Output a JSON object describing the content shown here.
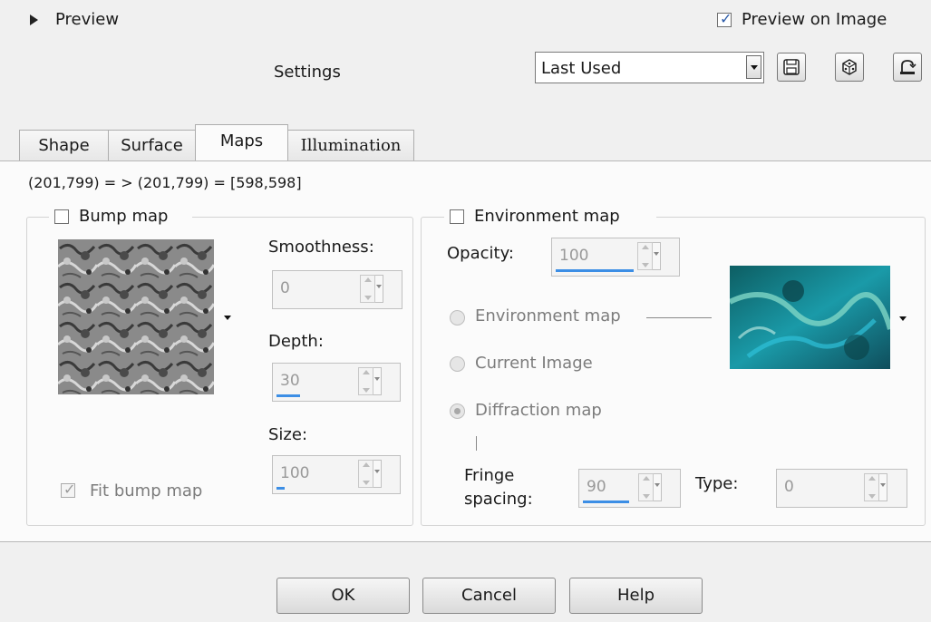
{
  "header": {
    "preview_label": "Preview",
    "preview_on_image_label": "Preview on Image",
    "preview_on_image_checked": true,
    "settings_label": "Settings",
    "settings_value": "Last Used",
    "icons": [
      "save-preset-icon",
      "random-dice-icon",
      "reset-icon"
    ]
  },
  "tabs": [
    {
      "label": "Shape",
      "active": false
    },
    {
      "label": "Surface",
      "active": false
    },
    {
      "label": "Maps",
      "active": true
    },
    {
      "label": "Illumination",
      "active": false
    }
  ],
  "coords": "(201,799) = > (201,799) = [598,598]",
  "bump_map": {
    "label": "Bump map",
    "checked": false,
    "smoothness_label": "Smoothness:",
    "smoothness_value": "0",
    "depth_label": "Depth:",
    "depth_value": "30",
    "depth_fraction": 0.3,
    "size_label": "Size:",
    "size_value": "100",
    "size_fraction": 0.1,
    "fit_label": "Fit bump map",
    "fit_checked": true
  },
  "environment_map": {
    "label": "Environment map",
    "checked": false,
    "opacity_label": "Opacity:",
    "opacity_value": "100",
    "opacity_fraction": 1.0,
    "radio_environment_label": "Environment map",
    "radio_current_label": "Current Image",
    "radio_diffraction_label": "Diffraction map",
    "selected_radio": "Diffraction map",
    "fringe_label_1": "Fringe",
    "fringe_label_2": "spacing:",
    "fringe_value": "90",
    "fringe_fraction": 0.9,
    "type_label": "Type:",
    "type_value": "0"
  },
  "buttons": {
    "ok": "OK",
    "cancel": "Cancel",
    "help": "Help"
  },
  "colors": {
    "accent": "#3c8ee5",
    "checkmark": "#2b5aa8",
    "env_preview": "#1a9aa8"
  }
}
